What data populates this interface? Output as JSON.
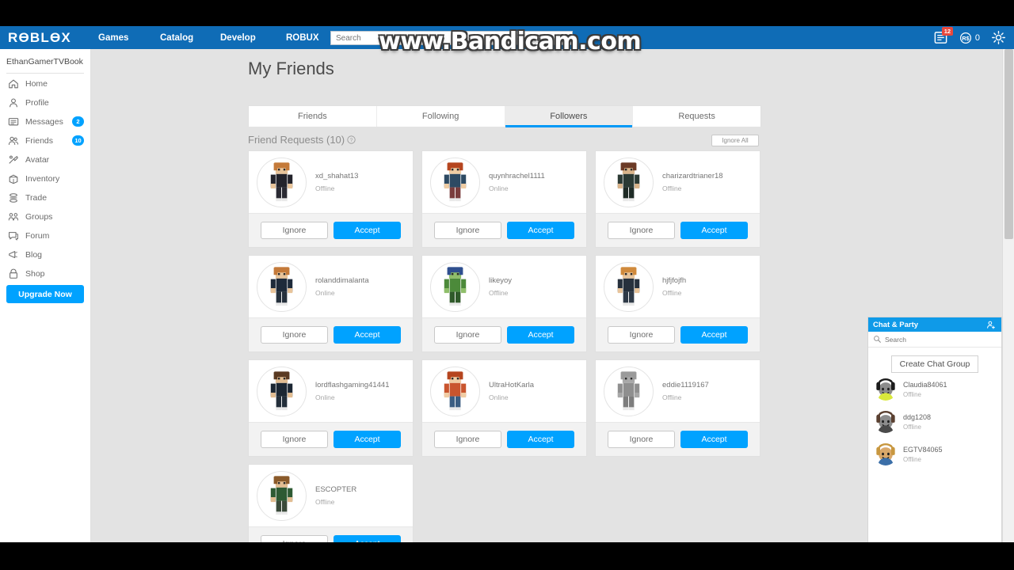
{
  "watermark": {
    "text": "www.Bandicam.com"
  },
  "header": {
    "logo": "RӨBLӨX",
    "nav": [
      {
        "label": "Games",
        "name": "nav-games"
      },
      {
        "label": "Catalog",
        "name": "nav-catalog"
      },
      {
        "label": "Develop",
        "name": "nav-develop"
      },
      {
        "label": "ROBUX",
        "name": "nav-robux"
      }
    ],
    "search": {
      "placeholder": "Search",
      "value": ""
    },
    "messages_badge": "12",
    "robux_amount": "0",
    "accent_color": "#0f6cb6"
  },
  "sidebar": {
    "username": "EthanGamerTVBook",
    "items": [
      {
        "label": "Home",
        "icon": "home-icon",
        "badge": ""
      },
      {
        "label": "Profile",
        "icon": "person-icon",
        "badge": ""
      },
      {
        "label": "Messages",
        "icon": "message-icon",
        "badge": "2"
      },
      {
        "label": "Friends",
        "icon": "friends-icon",
        "badge": "10"
      },
      {
        "label": "Avatar",
        "icon": "avatar-icon",
        "badge": ""
      },
      {
        "label": "Inventory",
        "icon": "inventory-icon",
        "badge": ""
      },
      {
        "label": "Trade",
        "icon": "trade-icon",
        "badge": ""
      },
      {
        "label": "Groups",
        "icon": "groups-icon",
        "badge": ""
      },
      {
        "label": "Forum",
        "icon": "forum-icon",
        "badge": ""
      },
      {
        "label": "Blog",
        "icon": "blog-icon",
        "badge": ""
      },
      {
        "label": "Shop",
        "icon": "shop-icon",
        "badge": ""
      }
    ],
    "upgrade_label": "Upgrade Now",
    "badge_color": "#00a2ff"
  },
  "main": {
    "title": "My Friends",
    "tabs": [
      {
        "label": "Friends",
        "active": false
      },
      {
        "label": "Following",
        "active": false
      },
      {
        "label": "Followers",
        "active": true
      },
      {
        "label": "Requests",
        "active": false
      }
    ],
    "requests_label": "Friend Requests (10)",
    "ignore_all_label": "Ignore All",
    "buttons": {
      "ignore": "Ignore",
      "accept": "Accept"
    },
    "accept_color": "#00a2ff",
    "requests": [
      {
        "username": "xd_shahat13",
        "status": "Offline",
        "hair": "#c47a3a",
        "shirt": "#23232b",
        "pants": "#2a2a33",
        "skin": "#e8c49a"
      },
      {
        "username": "quynhrachel1111",
        "status": "Online",
        "hair": "#b5451f",
        "shirt": "#2d4a63",
        "pants": "#7a3d3d",
        "skin": "#f0cda4"
      },
      {
        "username": "charizardtrianer18",
        "status": "Offline",
        "hair": "#6b3a26",
        "shirt": "#2b3a34",
        "pants": "#1f2b26",
        "skin": "#d9b48a"
      },
      {
        "username": "rolanddimalanta",
        "status": "Online",
        "hair": "#c47a3a",
        "shirt": "#1d2a3a",
        "pants": "#26313d",
        "skin": "#e8c49a"
      },
      {
        "username": "likeyoy",
        "status": "Offline",
        "hair": "#2f4f8f",
        "shirt": "#4c8a3a",
        "pants": "#2f5a2a",
        "skin": "#8fbf6a"
      },
      {
        "username": "hjfjfojfh",
        "status": "Offline",
        "hair": "#d08a3c",
        "shirt": "#26303c",
        "pants": "#2f3a47",
        "skin": "#e8c49a"
      },
      {
        "username": "lordflashgaming41441",
        "status": "Online",
        "hair": "#5a3a22",
        "shirt": "#1c2733",
        "pants": "#232e3a",
        "skin": "#e2bd92"
      },
      {
        "username": "UltraHotKarla",
        "status": "Online",
        "hair": "#b5451f",
        "shirt": "#c9552e",
        "pants": "#3b5d82",
        "skin": "#f0cda4"
      },
      {
        "username": "eddie1119167",
        "status": "Offline",
        "hair": "#9a9a9a",
        "shirt": "#8f8f8f",
        "pants": "#7d7d7d",
        "skin": "#a8a8a8"
      },
      {
        "username": "ESCOPTER",
        "status": "Offline",
        "hair": "#8a5a2a",
        "shirt": "#2d5a33",
        "pants": "#3a4a3a",
        "skin": "#e2bd92"
      }
    ]
  },
  "chat": {
    "title": "Chat & Party",
    "search_placeholder": "Search",
    "create_group_label": "Create Chat Group",
    "header_color": "#0f9ae8",
    "contacts": [
      {
        "name": "Claudia84061",
        "status": "Offline",
        "hair": "#1c1c1c",
        "face": "#8c8c8c",
        "shirt": "#d9e83c"
      },
      {
        "name": "ddg1208",
        "status": "Offline",
        "hair": "#5a4030",
        "face": "#8c8c8c",
        "shirt": "#4a4a4a"
      },
      {
        "name": "EGTV84065",
        "status": "Offline",
        "hair": "#c8973f",
        "face": "#d9a86a",
        "shirt": "#3b6fa8"
      }
    ]
  }
}
